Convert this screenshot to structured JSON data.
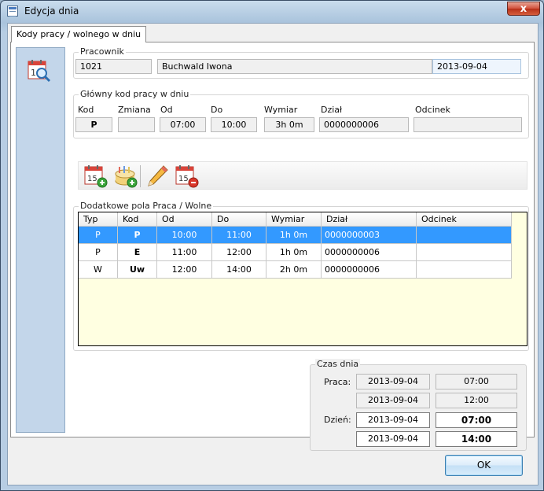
{
  "window": {
    "title": "Edycja dnia",
    "close_label": "x"
  },
  "tab": {
    "label": "Kody pracy / wolnego w dniu"
  },
  "pracownik": {
    "legend": "Pracownik",
    "id": "1021",
    "name": "Buchwald Iwona",
    "date": "2013-09-04"
  },
  "glowny": {
    "legend": "Główny kod pracy w dniu",
    "labels": {
      "kod": "Kod",
      "zmiana": "Zmiana",
      "od": "Od",
      "do": "Do",
      "wymiar": "Wymiar",
      "dzial": "Dział",
      "odcinek": "Odcinek"
    },
    "values": {
      "kod": "P",
      "zmiana": "",
      "od": "07:00",
      "do": "10:00",
      "wymiar": "3h 0m",
      "dzial": "0000000006",
      "odcinek": ""
    }
  },
  "toolbar": {
    "icons": [
      "add-day-icon",
      "add-group-icon",
      "edit-pencil-icon",
      "remove-day-icon"
    ],
    "cal_number": "15"
  },
  "dodatkowe": {
    "legend": "Dodatkowe pola Praca / Wolne",
    "columns": [
      "Typ",
      "Kod",
      "Od",
      "Do",
      "Wymiar",
      "Dział",
      "Odcinek"
    ],
    "rows": [
      {
        "typ": "P",
        "kod": "P",
        "od": "10:00",
        "do": "11:00",
        "wymiar": "1h 0m",
        "dzial": "0000000003",
        "odcinek": ""
      },
      {
        "typ": "P",
        "kod": "E",
        "od": "11:00",
        "do": "12:00",
        "wymiar": "1h 0m",
        "dzial": "0000000006",
        "odcinek": ""
      },
      {
        "typ": "W",
        "kod": "Uw",
        "od": "12:00",
        "do": "14:00",
        "wymiar": "2h 0m",
        "dzial": "0000000006",
        "odcinek": ""
      }
    ]
  },
  "czas": {
    "legend": "Czas dnia",
    "praca_label": "Praca:",
    "dzien_label": "Dzień:",
    "praca": [
      {
        "date": "2013-09-04",
        "time": "07:00"
      },
      {
        "date": "2013-09-04",
        "time": "12:00"
      }
    ],
    "dzien": [
      {
        "date": "2013-09-04",
        "time": "07:00"
      },
      {
        "date": "2013-09-04",
        "time": "14:00"
      }
    ]
  },
  "ok_label": "OK"
}
